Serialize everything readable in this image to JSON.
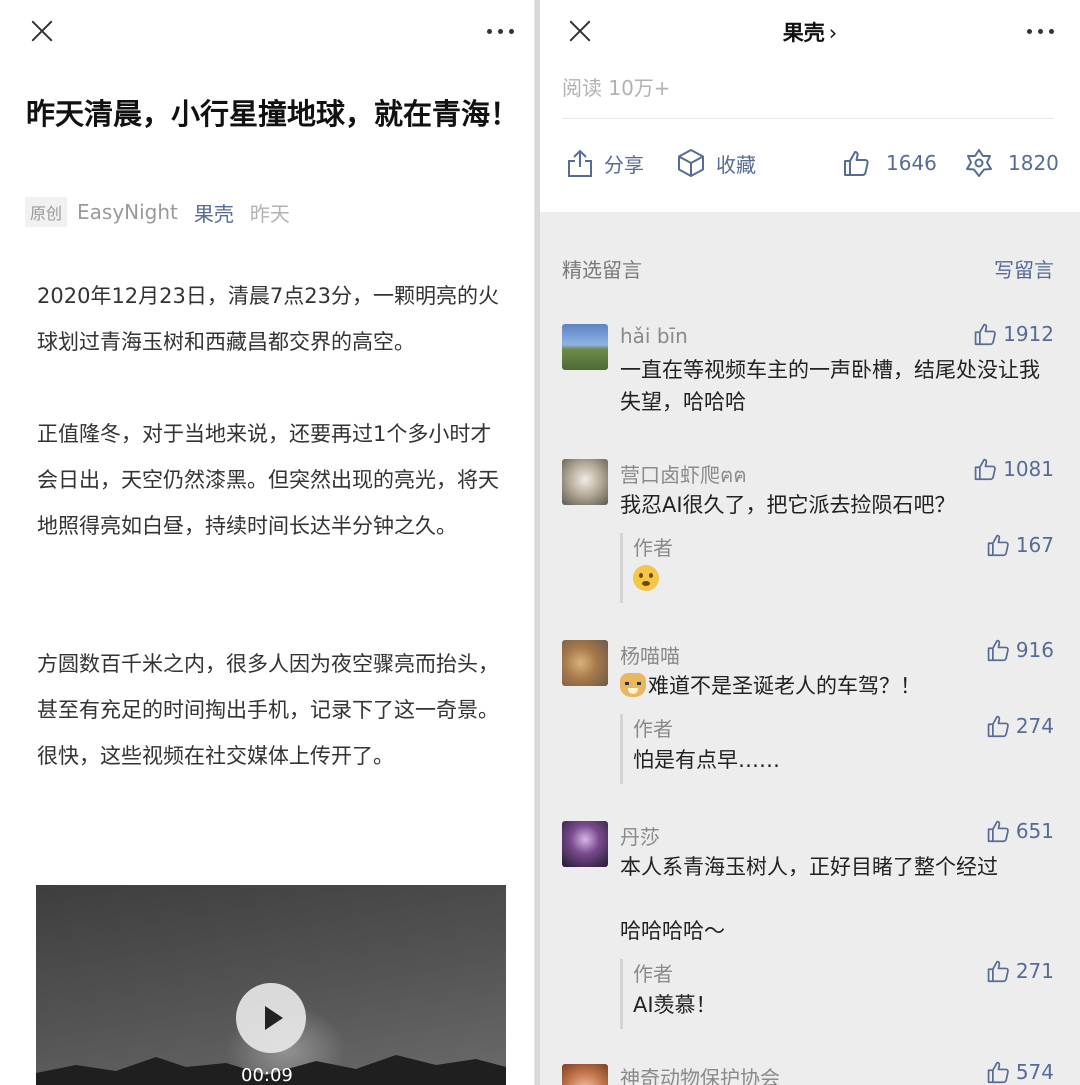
{
  "article": {
    "title": "昨天清晨，小行星撞地球，就在青海！",
    "tag": "原创",
    "author": "EasyNight",
    "account": "果壳",
    "date": "昨天",
    "paragraphs": [
      "2020年12月23日，清晨7点23分，一颗明亮的火球划过青海玉树和西藏昌都交界的高空。",
      "正值隆冬，对于当地来说，还要再过1个多小时才会日出，天空仍然漆黑。但突然出现的亮光，将天地照得亮如白昼，持续时间长达半分钟之久。",
      "方圆数百千米之内，很多人因为夜空骤亮而抬头，甚至有充足的时间掏出手机，记录下了这一奇景。很快，这些视频在社交媒体上传开了。"
    ],
    "video_time": "00:09"
  },
  "right_header": {
    "account_name": "果壳",
    "chevron": "›",
    "read_count": "阅读 10万+"
  },
  "actions": {
    "share": "分享",
    "favorite": "收藏",
    "likes": "1646",
    "wow": "1820"
  },
  "comments_section": {
    "title": "精选留言",
    "write": "写留言",
    "items": [
      {
        "name": "hǎi bīn",
        "likes": "1912",
        "text": "一直在等视频车主的一声卧槽，结尾处没让我失望，哈哈哈"
      },
      {
        "name": "营口卤虾爬ฅฅ",
        "likes": "1081",
        "text": "我忍AI很久了，把它派去捡陨石吧？",
        "reply": {
          "label": "作者",
          "likes": "167",
          "emoji": "flushed-emoji"
        }
      },
      {
        "name": "杨喵喵",
        "likes": "916",
        "text": "难道不是圣诞老人的车驾？！",
        "reply": {
          "label": "作者",
          "likes": "274",
          "text": "怕是有点早……"
        }
      },
      {
        "name": "丹莎",
        "likes": "651",
        "text_lines": [
          "本人系青海玉树人，正好目睹了整个经过",
          "哈哈哈哈～"
        ],
        "reply": {
          "label": "作者",
          "likes": "271",
          "text": "AI羡慕！"
        }
      },
      {
        "name": "神奇动物保护协会",
        "likes": "574"
      }
    ]
  },
  "colors": {
    "link": "#576b95",
    "muted": "#8a8a8a",
    "comment_bg": "#ededed"
  }
}
